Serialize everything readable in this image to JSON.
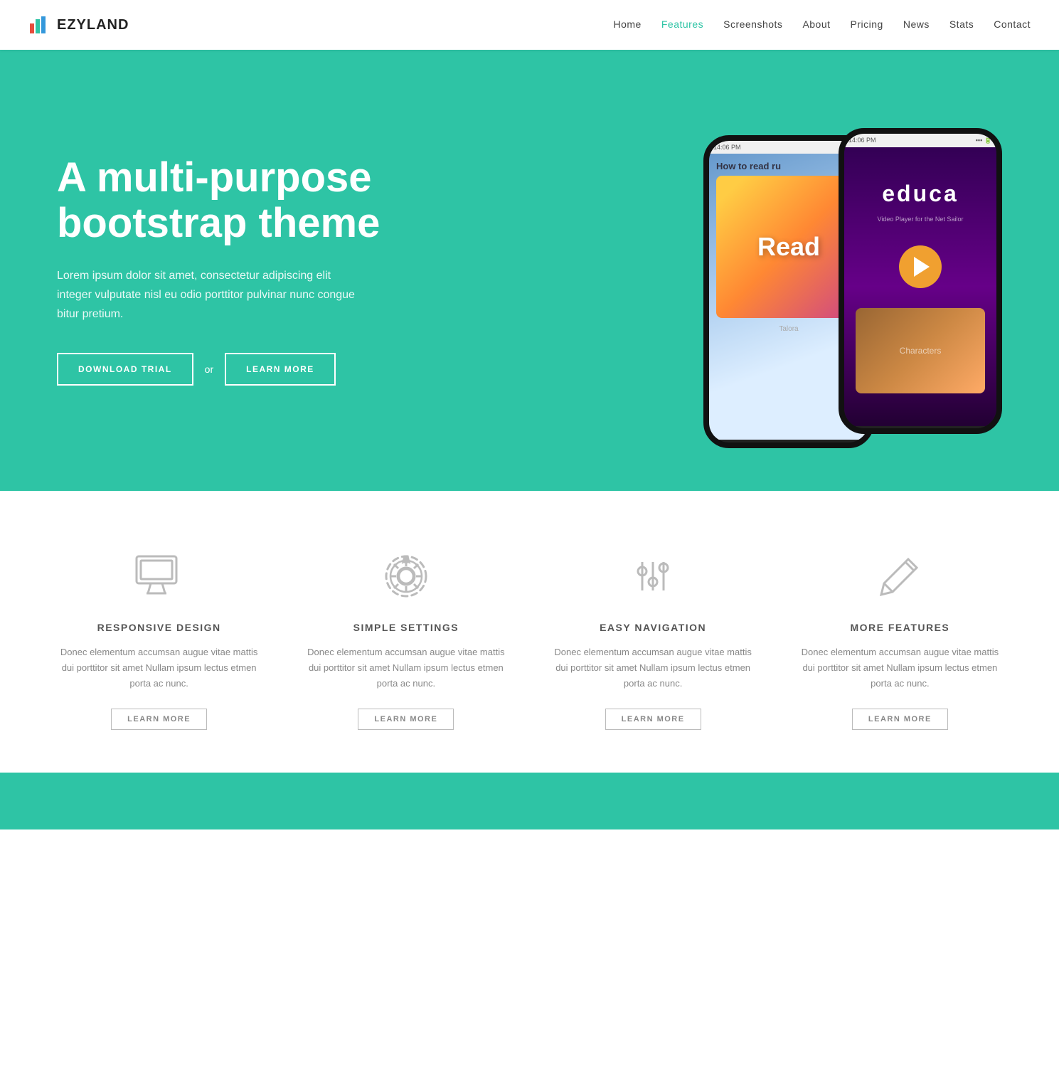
{
  "brand": {
    "name": "EZYLAND"
  },
  "nav": {
    "links": [
      {
        "label": "Home",
        "active": false
      },
      {
        "label": "Features",
        "active": true
      },
      {
        "label": "Screenshots",
        "active": false
      },
      {
        "label": "About",
        "active": false
      },
      {
        "label": "Pricing",
        "active": false
      },
      {
        "label": "News",
        "active": false
      },
      {
        "label": "Stats",
        "active": false
      },
      {
        "label": "Contact",
        "active": false
      }
    ]
  },
  "hero": {
    "title": "A multi-purpose bootstrap theme",
    "description": "Lorem ipsum dolor sit amet, consectetur adipiscing elit integer vulputate nisl eu odio porttitor pulvinar nunc congue bitur pretium.",
    "btn_trial": "DOWNLOAD TRIAL",
    "btn_or": "or",
    "btn_learn": "LEARN MORE"
  },
  "features": [
    {
      "icon": "monitor",
      "title": "RESPONSIVE DESIGN",
      "desc": "Donec elementum accumsan augue vitae mattis dui porttitor sit amet Nullam ipsum lectus etmen porta ac nunc.",
      "btn": "LEARN MORE"
    },
    {
      "icon": "settings",
      "title": "SIMPLE SETTINGS",
      "desc": "Donec elementum accumsan augue vitae mattis dui porttitor sit amet Nullam ipsum lectus etmen porta ac nunc.",
      "btn": "LEARN MORE"
    },
    {
      "icon": "navigation",
      "title": "EASY NAVIGATION",
      "desc": "Donec elementum accumsan augue vitae mattis dui porttitor sit amet Nullam ipsum lectus etmen porta ac nunc.",
      "btn": "LEARN MORE"
    },
    {
      "icon": "pencil",
      "title": "MORE FEATURES",
      "desc": "Donec elementum accumsan augue vitae mattis dui porttitor sit amet Nullam ipsum lectus etmen porta ac nunc.",
      "btn": "LEARN MORE"
    }
  ],
  "colors": {
    "teal": "#2ec4a5",
    "text_dark": "#222",
    "text_mid": "#555",
    "text_light": "#888",
    "border": "#bbb"
  }
}
